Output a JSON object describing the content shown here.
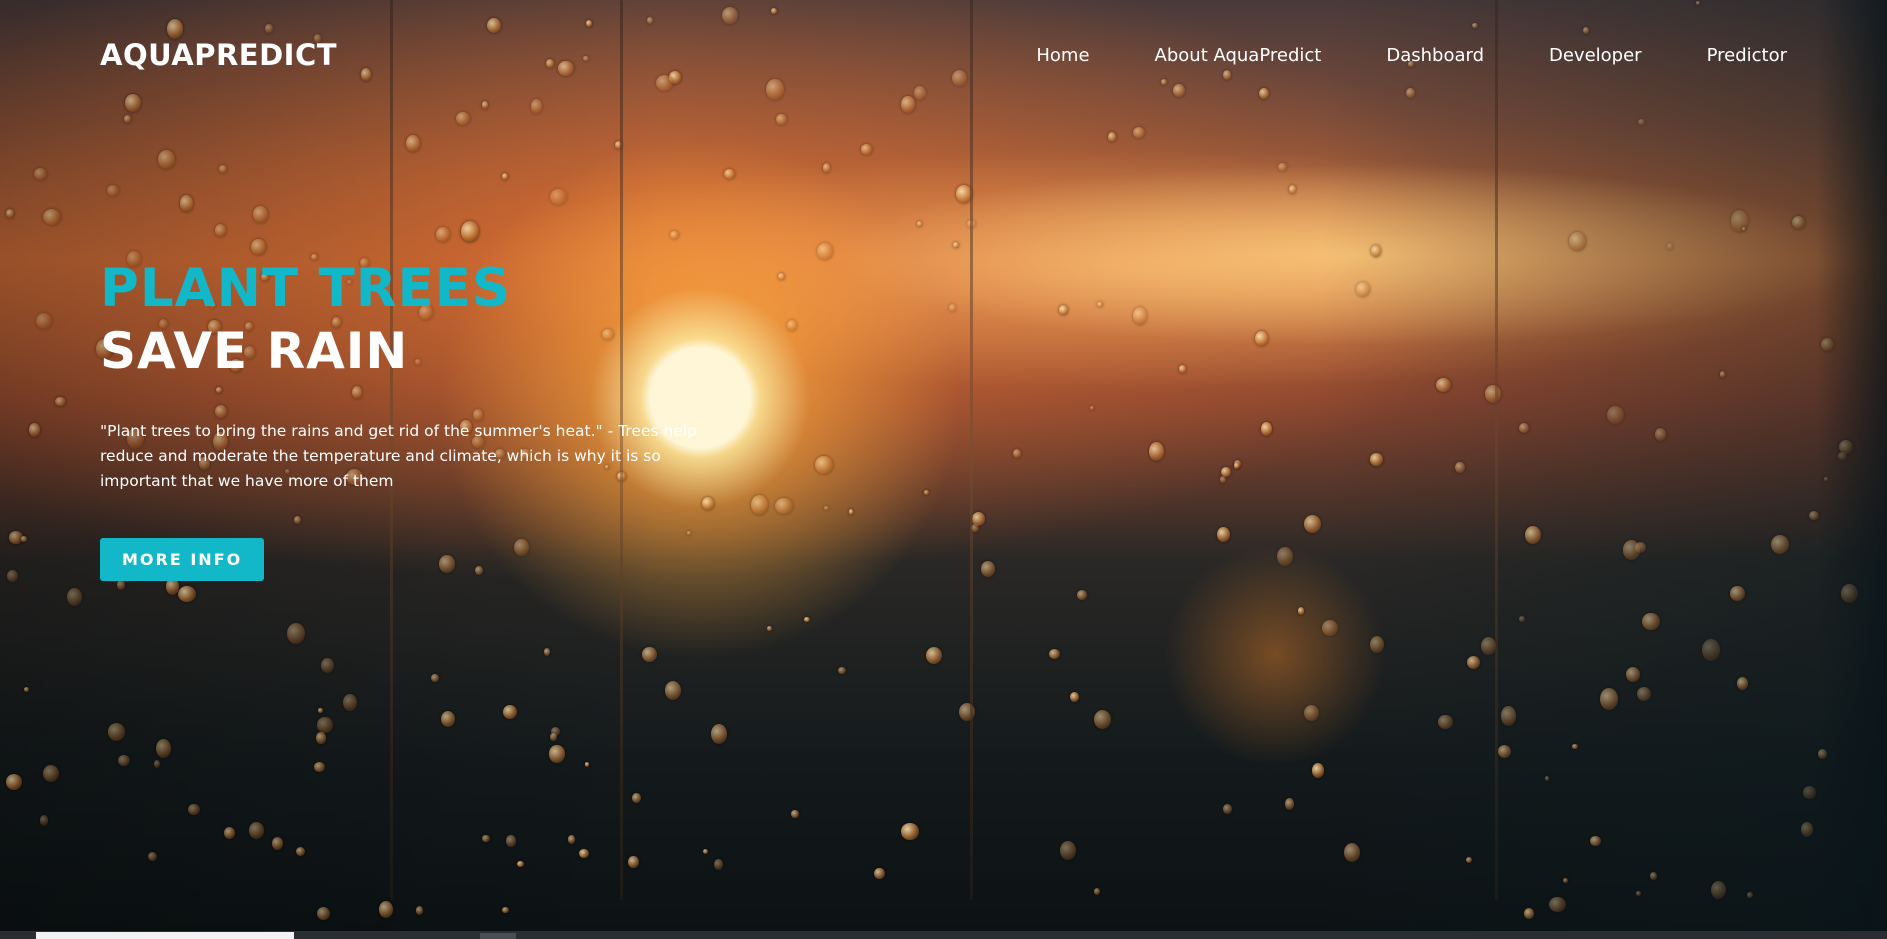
{
  "navbar": {
    "brand": "AQUAPREDICT",
    "links": [
      {
        "label": "Home"
      },
      {
        "label": "About AquaPredict"
      },
      {
        "label": "Dashboard"
      },
      {
        "label": "Developer"
      },
      {
        "label": "Predictor"
      }
    ]
  },
  "hero": {
    "headline_primary": "PLANT TREES",
    "headline_secondary": "SAVE RAIN",
    "quote": "\"Plant trees to bring the rains and get rid of the summer's heat.\" - Trees help reduce and moderate the temperature and climate, which is why it is so important that we have more of them",
    "cta_label": "MORE INFO"
  },
  "colors": {
    "accent": "#12b7c8",
    "text": "#ffffff"
  },
  "icons": {
    "background": "rainy-window-sunset-image"
  }
}
